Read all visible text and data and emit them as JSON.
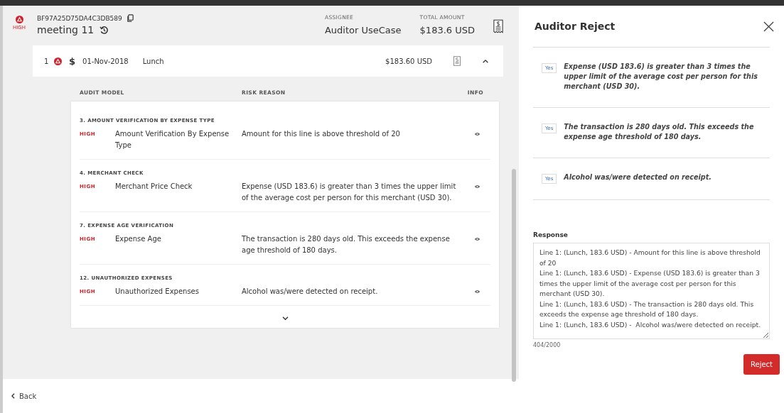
{
  "report": {
    "risk": "HIGH",
    "id": "BF97A25D75DA4C3DB589",
    "name": "meeting 11",
    "assignee_label": "ASSIGNEE",
    "assignee": "Auditor UseCase",
    "total_label": "TOTAL AMOUNT",
    "total": "$183.6 USD"
  },
  "line_item": {
    "number": "1",
    "currency": "$",
    "date": "01-Nov-2018",
    "category": "Lunch",
    "amount": "$183.60 USD",
    "expanded": true
  },
  "columns": [
    "AUDIT MODEL",
    "RISK REASON",
    "INFO"
  ],
  "audits": [
    {
      "title": "3. AMOUNT VERIFICATION BY EXPENSE TYPE",
      "risk": "HIGH",
      "model": "Amount Verification By Expense Type",
      "reason": "Amount for this line is above threshold of 20"
    },
    {
      "title": "4. MERCHANT CHECK",
      "risk": "HIGH",
      "model": "Merchant Price Check",
      "reason": "Expense (USD 183.6) is greater than 3 times the upper limit of the average cost per person for this merchant (USD 30)."
    },
    {
      "title": "7. EXPENSE AGE VERIFICATION",
      "risk": "HIGH",
      "model": "Expense Age",
      "reason": "The transaction is 280 days old. This exceeds the expense age threshold of 180 days."
    },
    {
      "title": "12. UNAUTHORIZED EXPENSES",
      "risk": "HIGH",
      "model": "Unauthorized Expenses",
      "reason": "Alcohol was/were detected on receipt."
    }
  ],
  "back": "Back",
  "panel": {
    "title": "Auditor Reject",
    "findings": [
      {
        "badge": "Yes",
        "text": "Expense (USD 183.6) is greater than 3 times the upper limit of the average cost per person for this merchant (USD 30)."
      },
      {
        "badge": "Yes",
        "text": "The transaction is 280 days old. This exceeds the expense age threshold of 180 days."
      },
      {
        "badge": "Yes",
        "text": "Alcohol was/were detected on receipt."
      }
    ],
    "response_label": "Response",
    "response": "Line 1: (Lunch, 183.6 USD) - Amount for this line is above threshold of 20\nLine 1: (Lunch, 183.6 USD) - Expense (USD 183.6) is greater than 3 times the upper limit of the average cost per person for this merchant (USD 30).\nLine 1: (Lunch, 183.6 USD) - The transaction is 280 days old. This exceeds the expense age threshold of 180 days.\nLine 1: (Lunch, 183.6 USD) -  Alcohol was/were detected on receipt.",
    "counter": "404/2000",
    "button": "Reject"
  }
}
